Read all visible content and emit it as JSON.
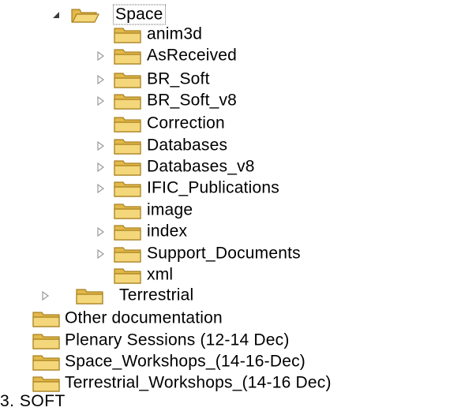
{
  "tree": {
    "root": {
      "label": "Space",
      "expanded": true,
      "selected": true
    },
    "space_children": [
      {
        "label": "anim3d",
        "expandable": false
      },
      {
        "label": "AsReceived",
        "expandable": true
      },
      {
        "label": "BR_Soft",
        "expandable": true
      },
      {
        "label": "BR_Soft_v8",
        "expandable": true
      },
      {
        "label": "Correction",
        "expandable": false
      },
      {
        "label": "Databases",
        "expandable": true
      },
      {
        "label": "Databases_v8",
        "expandable": true
      },
      {
        "label": "IFIC_Publications",
        "expandable": true
      },
      {
        "label": "image",
        "expandable": false
      },
      {
        "label": "index",
        "expandable": true
      },
      {
        "label": "Support_Documents",
        "expandable": true
      },
      {
        "label": "xml",
        "expandable": false
      }
    ],
    "terrestrial": {
      "label": "Terrestrial",
      "expandable": true
    },
    "top_level": [
      {
        "label": "Other documentation"
      },
      {
        "label": "Plenary Sessions (12-14 Dec)"
      },
      {
        "label": "Space_Workshops_(14-16-Dec)"
      },
      {
        "label": "Terrestrial_Workshops_(14-16 Dec)"
      }
    ],
    "cut_off_text": "3. SOFT"
  },
  "colors": {
    "folder_fill": "#f3d77a",
    "folder_shade": "#e2b94a",
    "folder_outline": "#a77f1f",
    "expander": "#9a9a9a",
    "expander_open": "#3c3c3c"
  },
  "icons": {
    "expander_collapsed": "triangle-right-outline",
    "expander_expanded": "triangle-down-filled",
    "folder": "folder-closed",
    "folder_open": "folder-open"
  }
}
